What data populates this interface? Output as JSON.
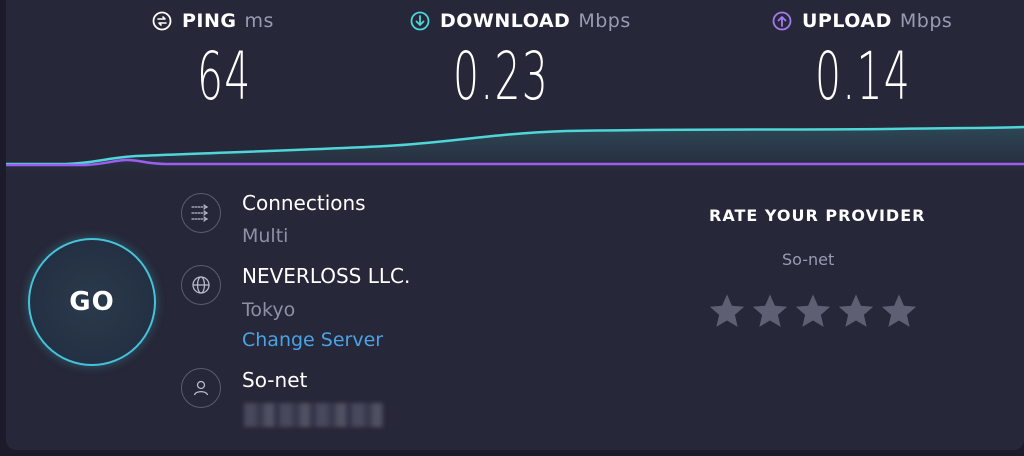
{
  "metrics": {
    "ping": {
      "label": "PING",
      "unit": "ms",
      "value": "64",
      "icon": "ping-icon",
      "color": "#ffffff"
    },
    "download": {
      "label": "DOWNLOAD",
      "unit": "Mbps",
      "value": "0.23",
      "icon": "download-arrow-icon",
      "color": "#4fd6d9"
    },
    "upload": {
      "label": "UPLOAD",
      "unit": "Mbps",
      "value": "0.14",
      "icon": "upload-arrow-icon",
      "color": "#a47bef"
    }
  },
  "go_button": {
    "label": "GO",
    "color": "#44c4d9"
  },
  "connections": {
    "title": "Connections",
    "value": "Multi",
    "icon": "connections-icon"
  },
  "server": {
    "name": "NEVERLOSS LLC.",
    "location": "Tokyo",
    "change_label": "Change Server",
    "icon": "globe-icon"
  },
  "provider": {
    "name": "So-net",
    "icon": "user-icon"
  },
  "rate": {
    "title": "RATE YOUR PROVIDER",
    "provider": "So-net",
    "stars": 5,
    "filled": 0
  },
  "colors": {
    "background": "#262738",
    "download_line": "#4fd6d9",
    "upload_line": "#9a5ff0",
    "link": "#4aa3e6"
  }
}
